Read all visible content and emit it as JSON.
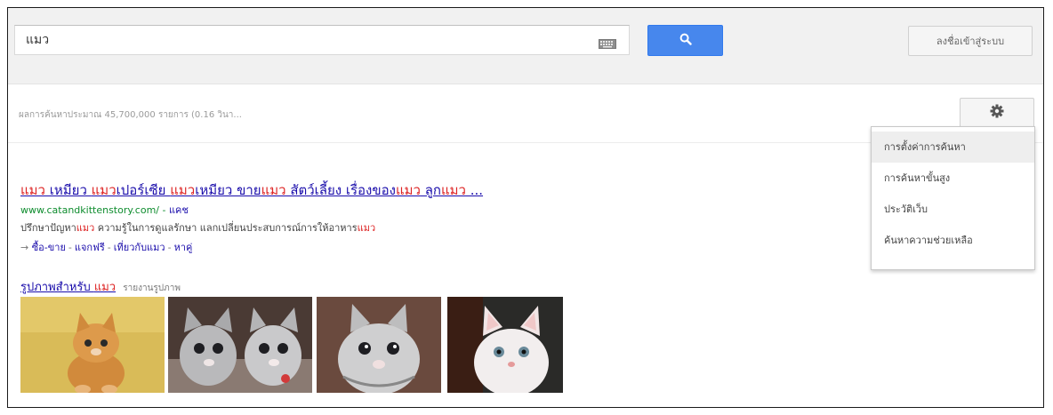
{
  "search": {
    "query": "แมว",
    "button_label": "",
    "icons": {
      "keyboard": "keyboard-icon",
      "search": "search-icon"
    },
    "button_color": "#4787ed"
  },
  "header": {
    "signin_label": "ลงชื่อเข้าสู่ระบบ"
  },
  "stats": {
    "text": "ผลการค้นหาประมาณ 45,700,000 รายการ (0.16 วินา..."
  },
  "settings": {
    "icon": "gear-icon",
    "menu": [
      {
        "label": "การตั้งค่าการค้นหา",
        "active": true
      },
      {
        "label": "การค้นหาขั้นสูง",
        "active": false
      },
      {
        "label": "ประวัติเว็บ",
        "active": false
      },
      {
        "label": "ค้นหาความช่วยเหลือ",
        "active": false
      }
    ]
  },
  "result": {
    "title_parts": [
      "แมว",
      " เหมียว ",
      "แมว",
      "เปอร์เซีย ",
      "แมว",
      "เหมียว ขาย",
      "แมว",
      " สัตว์เลี้ยง เรื่องของ",
      "แมว",
      " ลูก",
      "แมว",
      " ..."
    ],
    "url": "www.catandkittenstory.com/",
    "cache_label": "แคช",
    "snippet_parts": [
      "ปรึกษาปัญหา",
      "แมว",
      " ความรู้ในการดูแลรักษา แลกเปลี่ยนประสบการณ์การให้อาหาร",
      "แมว"
    ],
    "sitelinks": [
      "ซื้อ-ขาย",
      "แจกฟรี",
      "เที่ยวกับแมว",
      "หาคู่"
    ],
    "sitelink_arrow": "→"
  },
  "images": {
    "title_prefix": "รูปภาพสำหรับ ",
    "title_query": "แมว",
    "report_label": "รายงานรูปภาพ"
  },
  "colors": {
    "link": "#1a0dab",
    "highlight": "#dd2222",
    "url": "#0e8c2e"
  }
}
